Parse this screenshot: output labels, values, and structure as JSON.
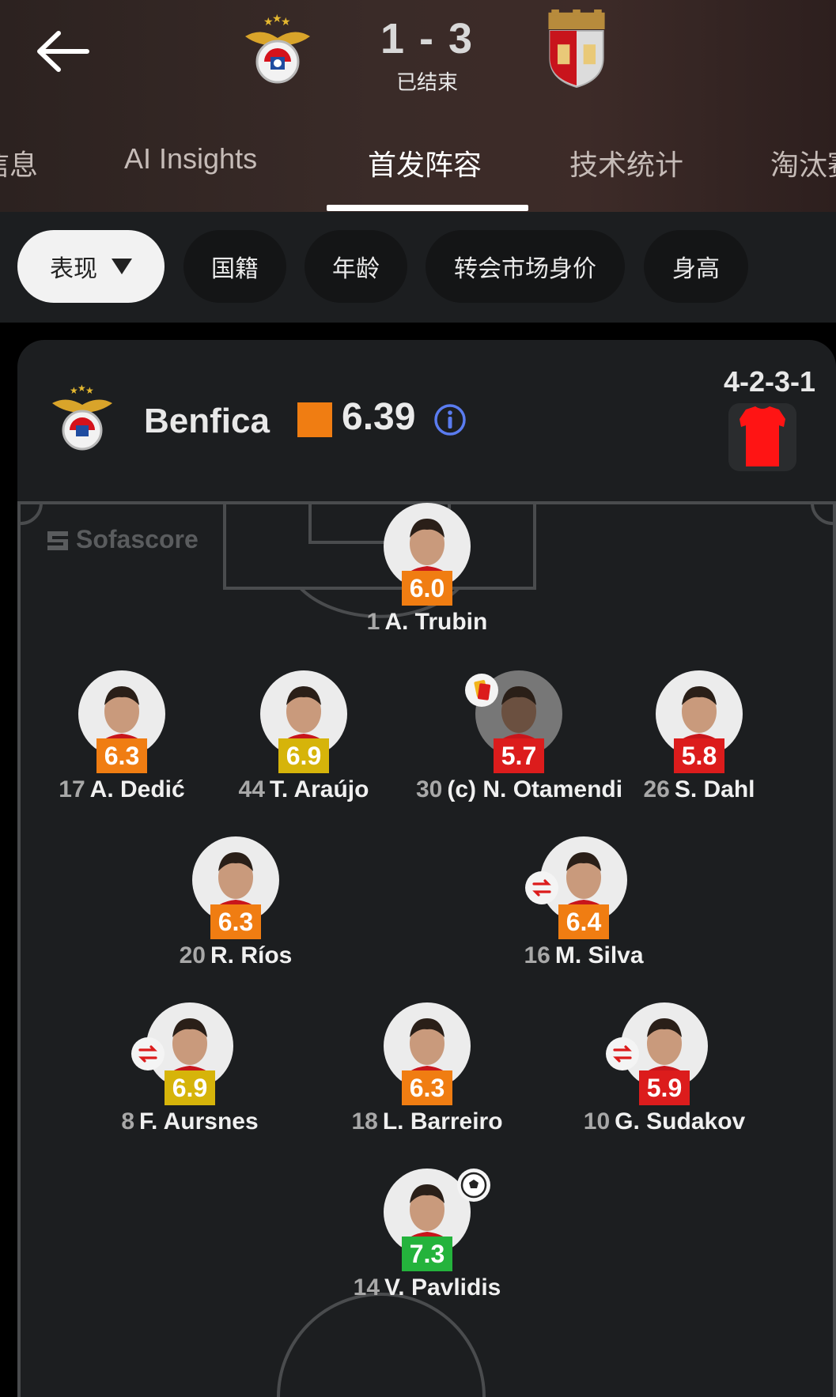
{
  "match": {
    "score": "1 - 3",
    "status": "已结束",
    "home_crest": "benfica-crest",
    "away_crest": "braga-crest"
  },
  "tabs": [
    {
      "label": "信息"
    },
    {
      "label": "AI Insights"
    },
    {
      "label": "首发阵容"
    },
    {
      "label": "技术统计"
    },
    {
      "label": "淘汰赛"
    }
  ],
  "filters": [
    {
      "label": "表现"
    },
    {
      "label": "国籍"
    },
    {
      "label": "年龄"
    },
    {
      "label": "转会市场身价"
    },
    {
      "label": "身高"
    }
  ],
  "team": {
    "name": "Benfica",
    "rating": "6.39",
    "formation": "4-2-3-1",
    "kit_color": "#ff1414"
  },
  "watermark": "Sofascore",
  "rating_colors": {
    "orange": "#f07d12",
    "yellow": "#d6b40a",
    "red": "#dc1c1c",
    "green": "#24b33c"
  },
  "players": [
    {
      "number": "1",
      "name": "A. Trubin",
      "rating": "6.0",
      "color": "orange"
    },
    {
      "number": "17",
      "name": "A. Dedić",
      "rating": "6.3",
      "color": "orange"
    },
    {
      "number": "44",
      "name": "T. Araújo",
      "rating": "6.9",
      "color": "yellow"
    },
    {
      "number": "30",
      "name": "(c) N. Otamendi",
      "rating": "5.7",
      "color": "red",
      "badge": "yellow-card-icon"
    },
    {
      "number": "26",
      "name": "S. Dahl",
      "rating": "5.8",
      "color": "red"
    },
    {
      "number": "20",
      "name": "R. Ríos",
      "rating": "6.3",
      "color": "orange"
    },
    {
      "number": "16",
      "name": "M. Silva",
      "rating": "6.4",
      "color": "orange",
      "badge": "substitution-icon"
    },
    {
      "number": "8",
      "name": "F. Aursnes",
      "rating": "6.9",
      "color": "yellow",
      "badge": "substitution-icon"
    },
    {
      "number": "18",
      "name": "L. Barreiro",
      "rating": "6.3",
      "color": "orange"
    },
    {
      "number": "10",
      "name": "G. Sudakov",
      "rating": "5.9",
      "color": "red",
      "badge": "substitution-icon"
    },
    {
      "number": "14",
      "name": "V. Pavlidis",
      "rating": "7.3",
      "color": "green",
      "badge": "goal-ball-icon"
    }
  ]
}
